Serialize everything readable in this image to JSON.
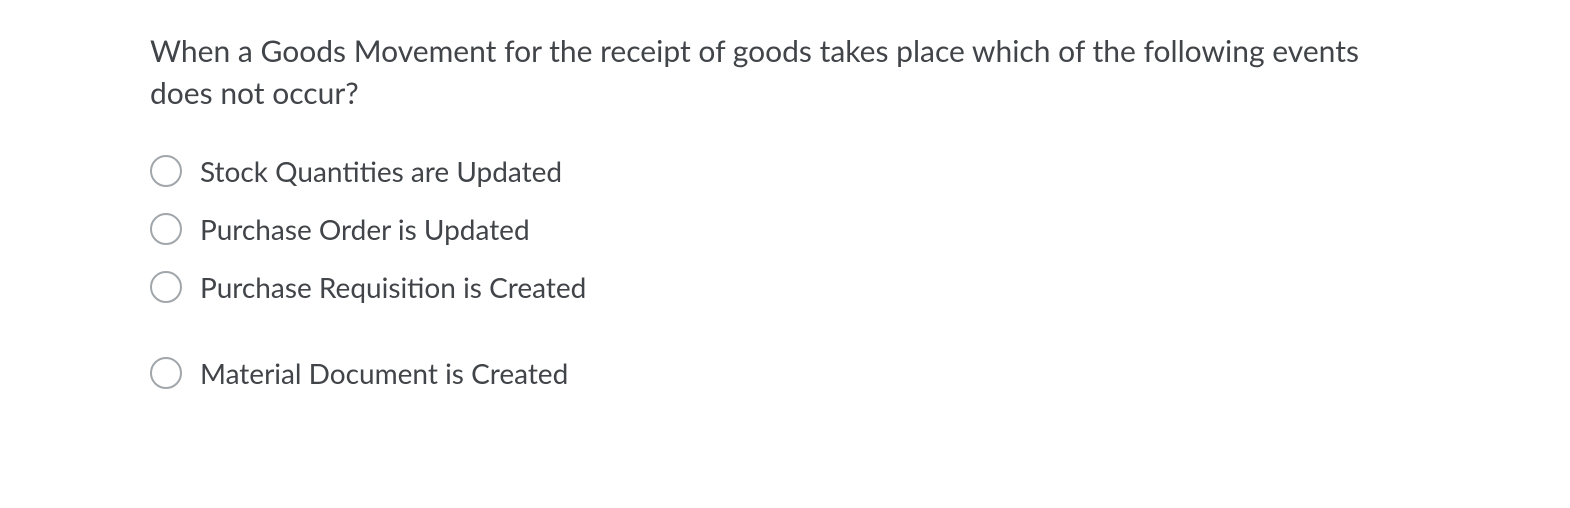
{
  "question": {
    "text": "When a Goods Movement for the receipt of goods takes place which of the following events does not occur?",
    "options": [
      {
        "label": "Stock Quantities are Updated",
        "selected": false
      },
      {
        "label": "Purchase Order is Updated",
        "selected": false
      },
      {
        "label": "Purchase Requisition is Created",
        "selected": false
      },
      {
        "label": "Material Document is Created",
        "selected": false
      }
    ]
  }
}
